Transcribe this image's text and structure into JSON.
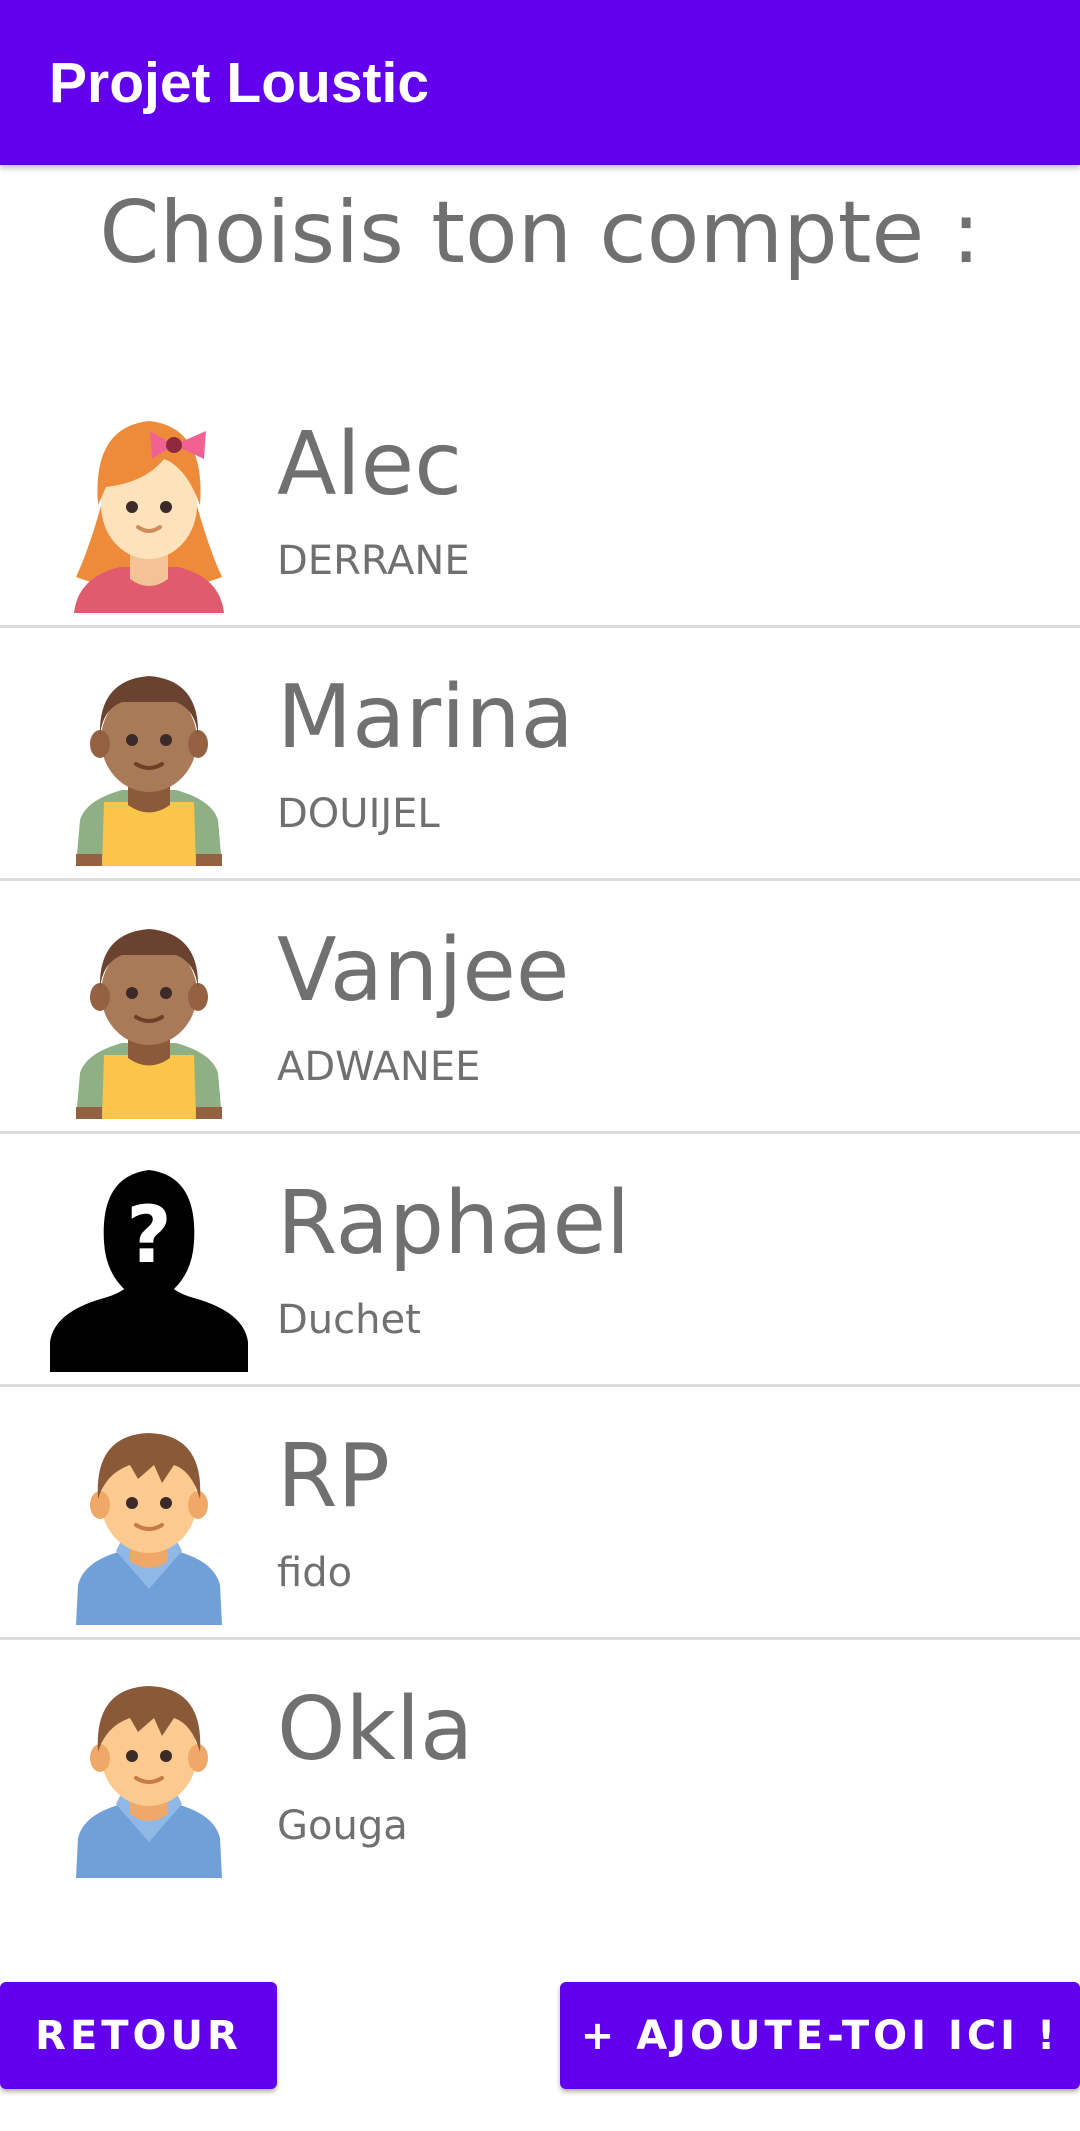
{
  "app": {
    "title": "Projet Loustic"
  },
  "heading": "Choisis ton compte :",
  "accounts": [
    {
      "first_name": "Alec",
      "last_name": "DERRANE",
      "avatar_icon": "girl-avatar-icon"
    },
    {
      "first_name": "Marina",
      "last_name": "DOUIJEL",
      "avatar_icon": "boy-dark-avatar-icon"
    },
    {
      "first_name": "Vanjee",
      "last_name": "ADWANEE",
      "avatar_icon": "boy-dark-avatar-icon"
    },
    {
      "first_name": "Raphael",
      "last_name": "Duchet",
      "avatar_icon": "unknown-user-icon"
    },
    {
      "first_name": "RP",
      "last_name": "fido",
      "avatar_icon": "boy-light-avatar-icon"
    },
    {
      "first_name": "Okla",
      "last_name": "Gouga",
      "avatar_icon": "boy-light-avatar-icon"
    }
  ],
  "buttons": {
    "back": "RETOUR",
    "add": "+ AJOUTE-TOI ICI !"
  },
  "colors": {
    "primary": "#6200ee",
    "text_gray": "#707070",
    "divider": "#dcdcdc"
  }
}
